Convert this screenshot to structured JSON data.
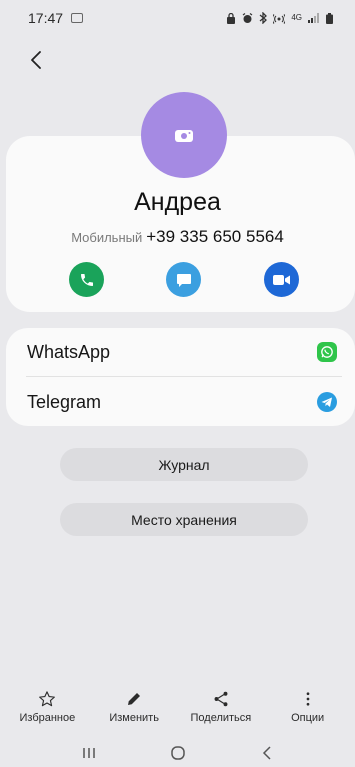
{
  "status_bar": {
    "time": "17:47",
    "network": "4G"
  },
  "contact": {
    "name": "Андреа",
    "phone_type": "Мобильный",
    "phone_number": "+39 335 650 5564",
    "avatar_color": "#a58ae3"
  },
  "apps": [
    {
      "label": "WhatsApp",
      "icon": "whatsapp-icon",
      "color": "#2fc54a"
    },
    {
      "label": "Telegram",
      "icon": "telegram-icon",
      "color": "#2a9de0"
    }
  ],
  "buttons": {
    "log": "Журнал",
    "storage": "Место хранения"
  },
  "bottom_bar": [
    {
      "label": "Избранное",
      "icon": "star-icon"
    },
    {
      "label": "Изменить",
      "icon": "pencil-icon"
    },
    {
      "label": "Поделиться",
      "icon": "share-icon"
    },
    {
      "label": "Опции",
      "icon": "more-vertical-icon"
    }
  ],
  "colors": {
    "call": "#1aa35a",
    "message": "#3b9fe0",
    "video": "#1e68d6"
  }
}
